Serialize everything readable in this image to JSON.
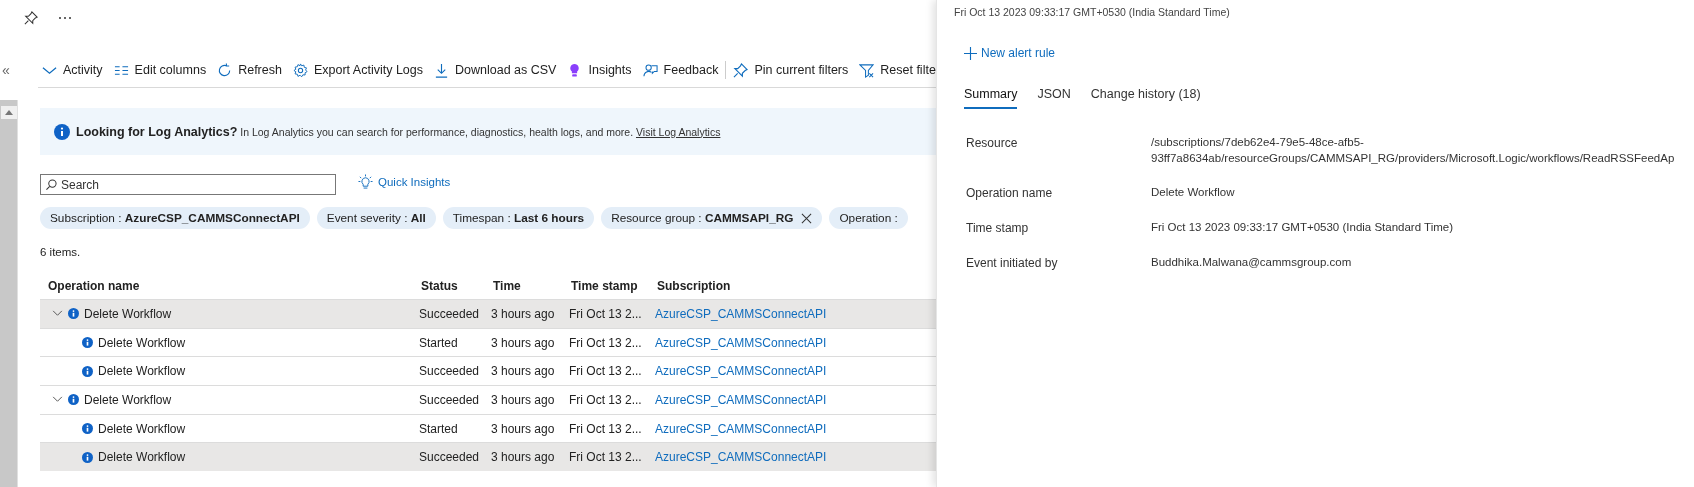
{
  "header": {
    "collapse_glyph": "«"
  },
  "toolbar": [
    {
      "label": "Activity",
      "separator_before": false
    },
    {
      "label": "Edit columns",
      "separator_before": false
    },
    {
      "label": "Refresh",
      "separator_before": false
    },
    {
      "label": "Export Activity Logs",
      "separator_before": false
    },
    {
      "label": "Download as CSV",
      "separator_before": false
    },
    {
      "label": "Insights",
      "separator_before": false
    },
    {
      "label": "Feedback",
      "separator_before": false
    },
    {
      "label": "Pin current filters",
      "separator_before": true
    },
    {
      "label": "Reset filte",
      "separator_before": false
    }
  ],
  "banner": {
    "title": "Looking for Log Analytics?",
    "text": "In Log Analytics you can search for performance, diagnostics, health logs, and more.",
    "link": "Visit Log Analytics"
  },
  "search": {
    "placeholder": "Search"
  },
  "quick_insights": "Quick Insights",
  "filters": [
    {
      "name": "Subscription :",
      "value": "AzureCSP_CAMMSConnectAPI",
      "removable": false
    },
    {
      "name": "Event severity :",
      "value": "All",
      "removable": false
    },
    {
      "name": "Timespan :",
      "value": "Last 6 hours",
      "removable": false
    },
    {
      "name": "Resource group :",
      "value": "CAMMSAPI_RG",
      "removable": true
    },
    {
      "name": "Operation :",
      "removable": false
    }
  ],
  "item_count": "6 items.",
  "table": {
    "columns": [
      "Operation name",
      "Status",
      "Time",
      "Time stamp",
      "Subscription"
    ],
    "rows": [
      {
        "operation": "Delete Workflow",
        "status": "Succeeded",
        "time": "3 hours ago",
        "timestamp": "Fri Oct 13 2...",
        "subscription": "AzureCSP_CAMMSConnectAPI",
        "expanded": true,
        "selected": true,
        "children": [
          {
            "operation": "Delete Workflow",
            "status": "Started",
            "time": "3 hours ago",
            "timestamp": "Fri Oct 13 2...",
            "subscription": "AzureCSP_CAMMSConnectAPI",
            "selected": false
          },
          {
            "operation": "Delete Workflow",
            "status": "Succeeded",
            "time": "3 hours ago",
            "timestamp": "Fri Oct 13 2...",
            "subscription": "AzureCSP_CAMMSConnectAPI",
            "selected": false
          }
        ]
      },
      {
        "operation": "Delete Workflow",
        "status": "Succeeded",
        "time": "3 hours ago",
        "timestamp": "Fri Oct 13 2...",
        "subscription": "AzureCSP_CAMMSConnectAPI",
        "expanded": true,
        "selected": false,
        "children": [
          {
            "operation": "Delete Workflow",
            "status": "Started",
            "time": "3 hours ago",
            "timestamp": "Fri Oct 13 2...",
            "subscription": "AzureCSP_CAMMSConnectAPI",
            "selected": false
          },
          {
            "operation": "Delete Workflow",
            "status": "Succeeded",
            "time": "3 hours ago",
            "timestamp": "Fri Oct 13 2...",
            "subscription": "AzureCSP_CAMMSConnectAPI",
            "selected": true
          }
        ]
      }
    ]
  },
  "details": {
    "subtitle": "Fri Oct 13 2023 09:33:17 GMT+0530 (India Standard Time)",
    "new_alert_rule": "New alert rule",
    "tabs": [
      {
        "label": "Summary",
        "selected": true
      },
      {
        "label": "JSON",
        "selected": false
      },
      {
        "label": "Change history (18)",
        "selected": false
      }
    ],
    "fields": [
      {
        "label": "Resource",
        "value": "/subscriptions/7deb62e4-79e5-48ce-afb5-93ff7a8634ab/resourceGroups/CAMMSAPI_RG/providers/Microsoft.Logic/workflows/ReadRSSFeedAp"
      },
      {
        "label": "Operation name",
        "value": "Delete Workflow"
      },
      {
        "label": "Time stamp",
        "value": "Fri Oct 13 2023 09:33:17 GMT+0530 (India Standard Time)"
      },
      {
        "label": "Event initiated by",
        "value": "Buddhika.Malwana@cammsgroup.com"
      }
    ]
  }
}
